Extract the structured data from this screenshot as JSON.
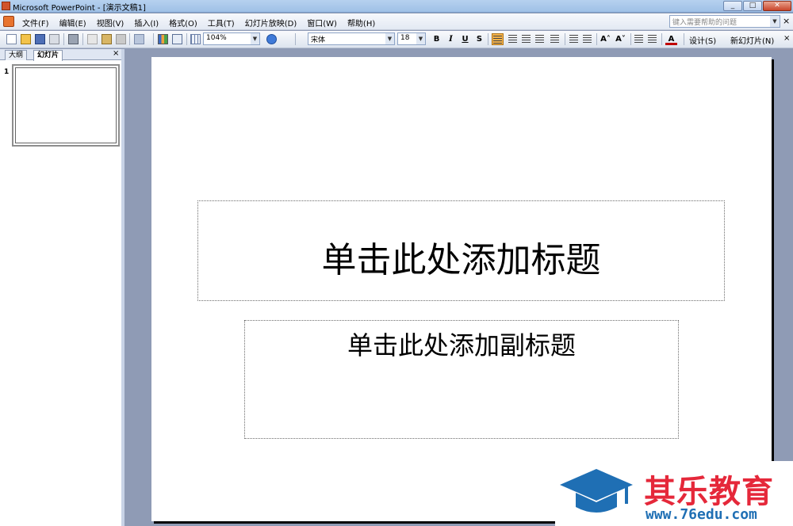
{
  "window": {
    "title": "Microsoft PowerPoint - [演示文稿1]",
    "controls": [
      "_",
      "□",
      "✕"
    ]
  },
  "menubar": {
    "items": [
      "文件(F)",
      "编辑(E)",
      "视图(V)",
      "插入(I)",
      "格式(O)",
      "工具(T)",
      "幻灯片放映(D)",
      "窗口(W)",
      "帮助(H)"
    ],
    "help_placeholder": "键入需要帮助的问题",
    "close": "×"
  },
  "toolbar": {
    "zoom": "104%",
    "font_name": "宋体",
    "font_size": "18",
    "bold": "B",
    "italic": "I",
    "underline": "U",
    "shadow": "S",
    "font_color_label": "A",
    "increase_font": "A˄",
    "decrease_font": "A˅",
    "design_label": "设计(S)",
    "new_slide_label": "新幻灯片(N)",
    "close": "×"
  },
  "left_pane": {
    "tabs": [
      "大纲",
      "幻灯片"
    ],
    "active_tab": "幻灯片",
    "close": "×",
    "slides": [
      {
        "number": "1"
      }
    ]
  },
  "slide": {
    "title_placeholder": "单击此处添加标题",
    "subtitle_placeholder": "单击此处添加副标题"
  },
  "watermark": {
    "name": "其乐教育",
    "url": "www.76edu.com",
    "colors": {
      "name": "#e5283a",
      "url": "#1f6fb4",
      "cap": "#1f6fb4"
    }
  }
}
